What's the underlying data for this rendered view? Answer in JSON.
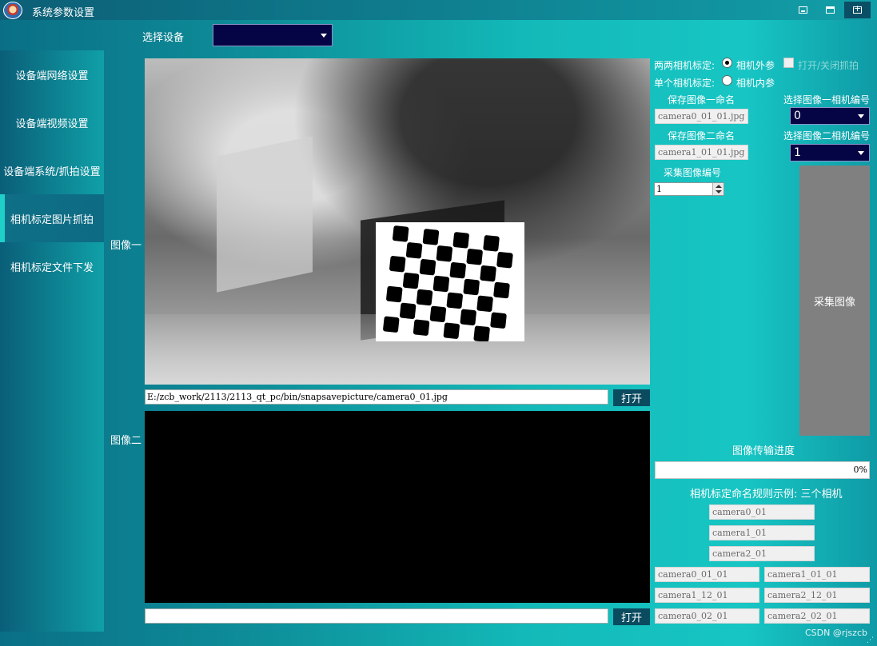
{
  "window": {
    "title": "系统参数设置",
    "controls": {
      "minimize": "minimize-icon",
      "maximize": "maximize-icon",
      "close": "close-icon"
    }
  },
  "device": {
    "label": "选择设备",
    "selected": ""
  },
  "sidebar": {
    "items": [
      {
        "label": "设备端网络设置",
        "active": false
      },
      {
        "label": "设备端视频设置",
        "active": false
      },
      {
        "label": "设备端系统/抓拍设置",
        "active": false
      },
      {
        "label": "相机标定图片抓拍",
        "active": true
      },
      {
        "label": "相机标定文件下发",
        "active": false
      }
    ]
  },
  "images": {
    "image1_label": "图像一",
    "image2_label": "图像二",
    "path1": "E:/zcb_work/2113/2113_qt_pc/bin/snapsavepicture/camera0_01.jpg",
    "path2": "",
    "open_label": "打开"
  },
  "calibration": {
    "pair_label": "两两相机标定:",
    "pair_option": "相机外参",
    "single_label": "单个相机标定:",
    "single_option": "相机内参",
    "capture_toggle": "打开/关闭抓拍",
    "save_name1_label": "保存图像一命名",
    "save_name1_value": "camera0_01_01.jpg",
    "save_name2_label": "保存图像二命名",
    "save_name2_value": "camera1_01_01.jpg",
    "select_cam1_label": "选择图像一相机编号",
    "select_cam1_value": "0",
    "select_cam2_label": "选择图像二相机编号",
    "select_cam2_value": "1",
    "capture_index_label": "采集图像编号",
    "capture_index_value": "1",
    "capture_button": "采集图像",
    "progress_label": "图像传输进度",
    "progress_percent": 0,
    "progress_text": "0%",
    "naming_rule_label": "相机标定命名规则示例: 三个相机",
    "examples_single": [
      "camera0_01",
      "camera1_01",
      "camera2_01"
    ],
    "examples_pairs": [
      [
        "camera0_01_01",
        "camera1_01_01"
      ],
      [
        "camera1_12_01",
        "camera2_12_01"
      ],
      [
        "camera0_02_01",
        "camera2_02_01"
      ]
    ]
  },
  "watermark": "CSDN @rjszcb",
  "colors": {
    "accent": "#17c6c4",
    "button_dark": "#0b4b60",
    "combo_bg": "#050545",
    "progress": "#06b025"
  }
}
